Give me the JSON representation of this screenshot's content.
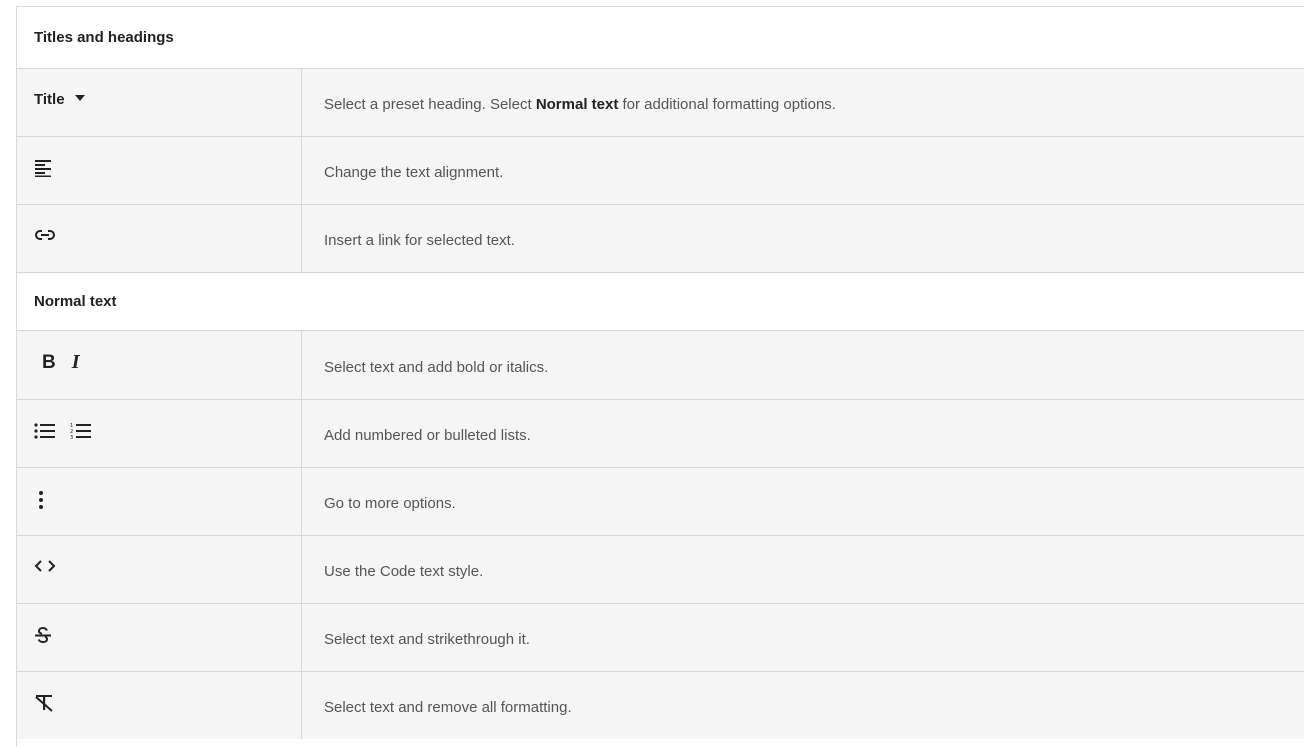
{
  "sections": {
    "titles": "Titles and headings",
    "normal": "Normal text"
  },
  "title_dropdown": {
    "label": "Title"
  },
  "rows": {
    "heading": {
      "pre": "Select a preset heading. Select ",
      "bold": "Normal text",
      "post": " for additional formatting options."
    },
    "align": "Change the text alignment.",
    "link": "Insert a link for selected text.",
    "bold_italic": "Select text and add bold or italics.",
    "lists": "Add numbered or bulleted lists.",
    "more": "Go to more options.",
    "code": "Use the Code text style.",
    "strike": "Select text and strikethrough it.",
    "clear": "Select text and remove all formatting."
  },
  "icons": {
    "bold_glyph": "B",
    "italic_glyph": "I"
  }
}
